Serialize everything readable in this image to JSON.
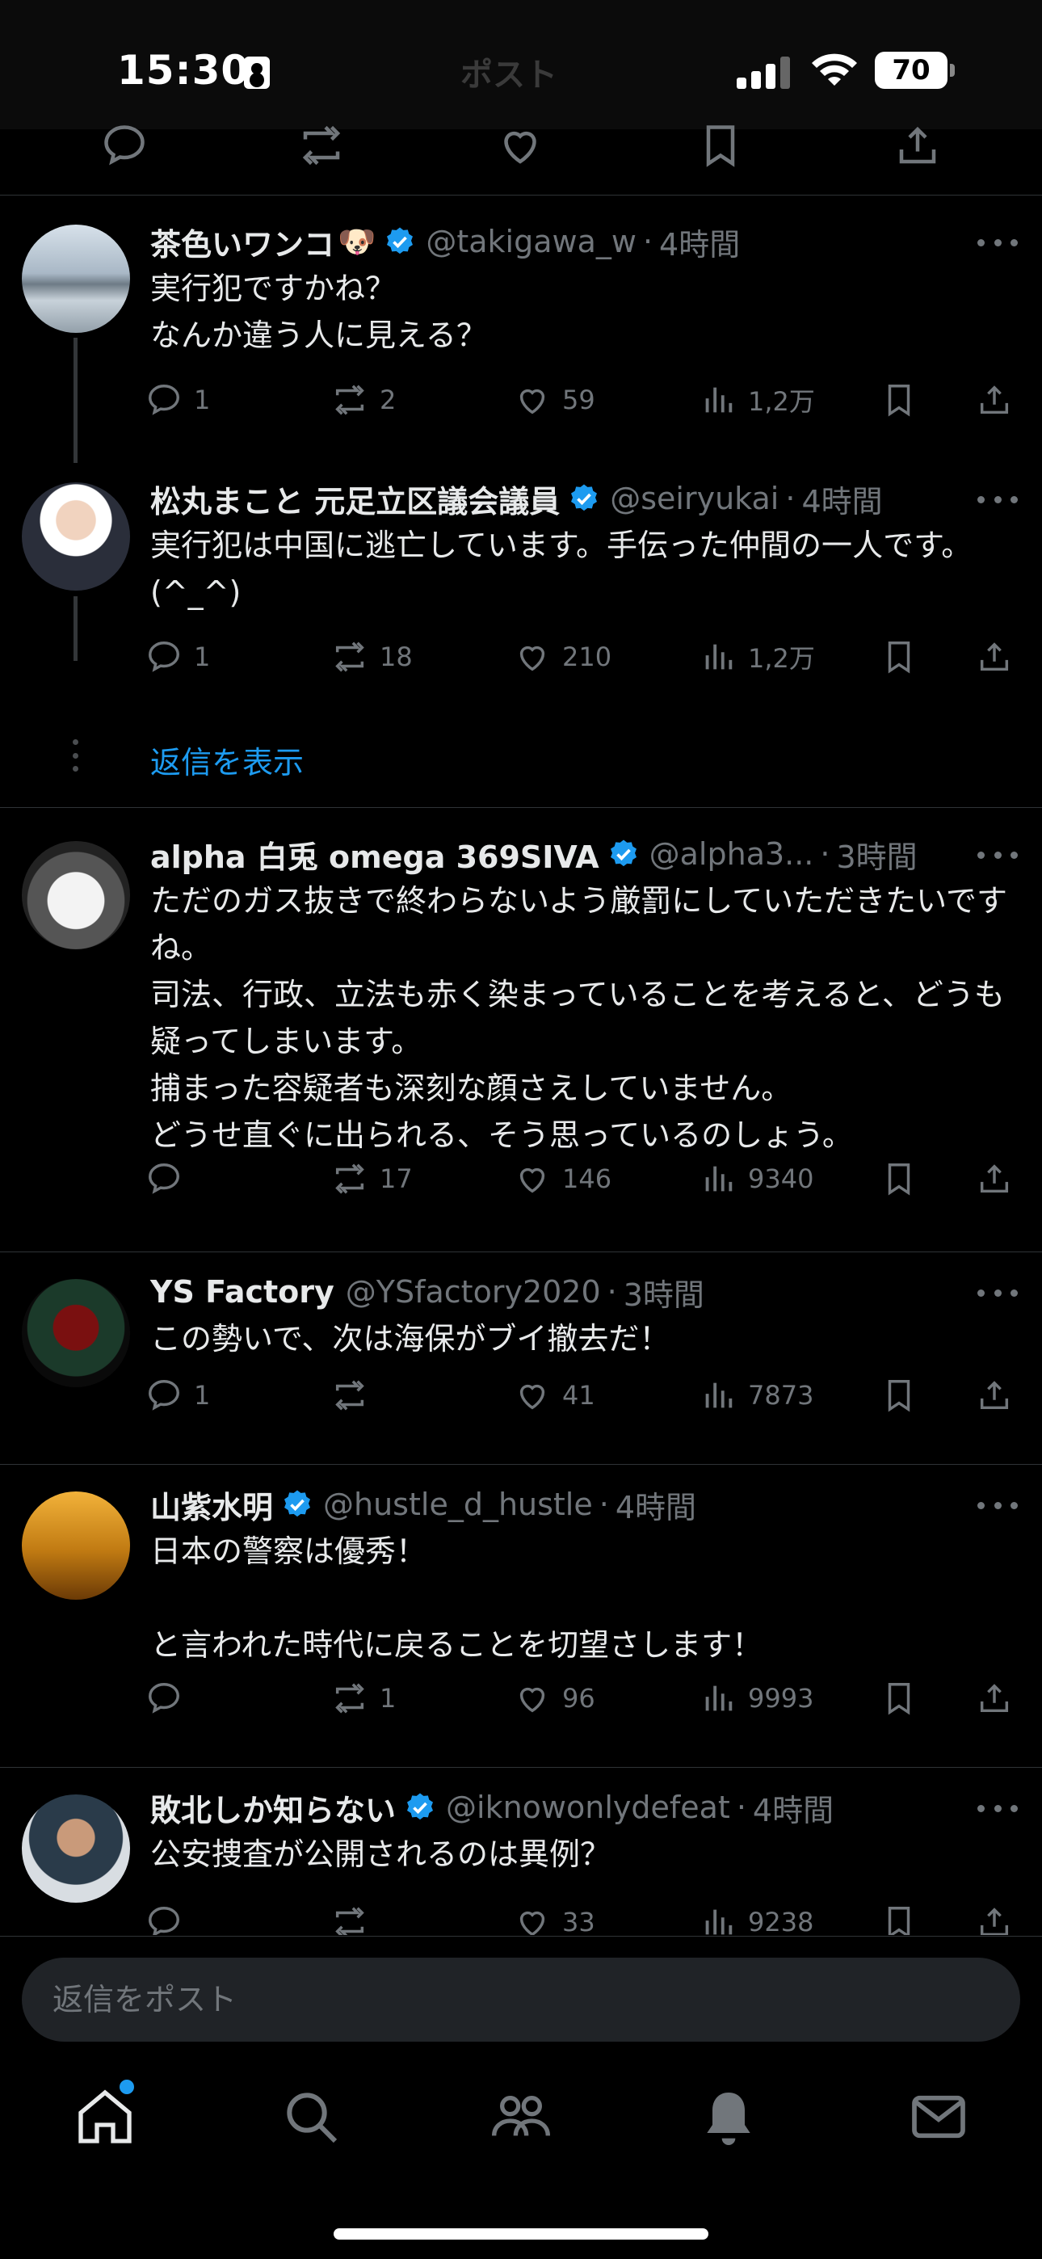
{
  "status_bar": {
    "time": "15:30",
    "battery": "70",
    "ghost_title": "ポスト"
  },
  "colors": {
    "background": "#000000",
    "text": "#e7e9ea",
    "secondary": "#71767b",
    "accent": "#1d9bf0",
    "divider": "#2f3336"
  },
  "tweets": [
    {
      "name": "茶色いワンコ",
      "emoji": "🐶",
      "verified": true,
      "handle": "@takigawa_w",
      "time": "4時間",
      "text": "実行犯ですかね？\nなんか違う人に見える？",
      "replies": "1",
      "reposts": "2",
      "likes": "59",
      "views": "1,2万"
    },
    {
      "name": "松丸まこと 元足立区議会議員",
      "verified": true,
      "handle": "@seiryukai",
      "time": "4時間",
      "text": "実行犯は中国に逃亡しています。手伝った仲間の一人です。(^_^)",
      "replies": "1",
      "reposts": "18",
      "likes": "210",
      "views": "1,2万"
    },
    {
      "name": "alpha 白兎 omega 369SIVA",
      "verified": true,
      "handle": "@alpha3...",
      "time": "3時間",
      "text": "ただのガス抜きで終わらないよう厳罰にしていただきたいですね。\n司法、行政、立法も赤く染まっていることを考えると、どうも疑ってしまいます。\n捕まった容疑者も深刻な顔さえしていません。\nどうせ直ぐに出られる、そう思っているのしょう。",
      "replies": "",
      "reposts": "17",
      "likes": "146",
      "views": "9340"
    },
    {
      "name": "YS Factory",
      "verified": false,
      "handle": "@YSfactory2020",
      "time": "3時間",
      "text": "この勢いで、次は海保がブイ撤去だ！",
      "replies": "1",
      "reposts": "",
      "likes": "41",
      "views": "7873"
    },
    {
      "name": "山紫水明",
      "verified": true,
      "handle": "@hustle_d_hustle",
      "time": "4時間",
      "text": "日本の警察は優秀！\n\nと言われた時代に戻ることを切望さします！",
      "replies": "",
      "reposts": "1",
      "likes": "96",
      "views": "9993"
    },
    {
      "name": "敗北しか知らない",
      "verified": true,
      "handle": "@iknowonlydefeat",
      "time": "4時間",
      "text": "公安捜査が公開されるのは異例？",
      "replies": "",
      "reposts": "",
      "likes": "33",
      "views": "9238"
    }
  ],
  "show_replies_label": "返信を表示",
  "reply_bar": {
    "placeholder": "返信をポスト"
  },
  "tabs": [
    "home-icon",
    "search-icon",
    "communities-icon",
    "notifications-icon",
    "messages-icon"
  ]
}
